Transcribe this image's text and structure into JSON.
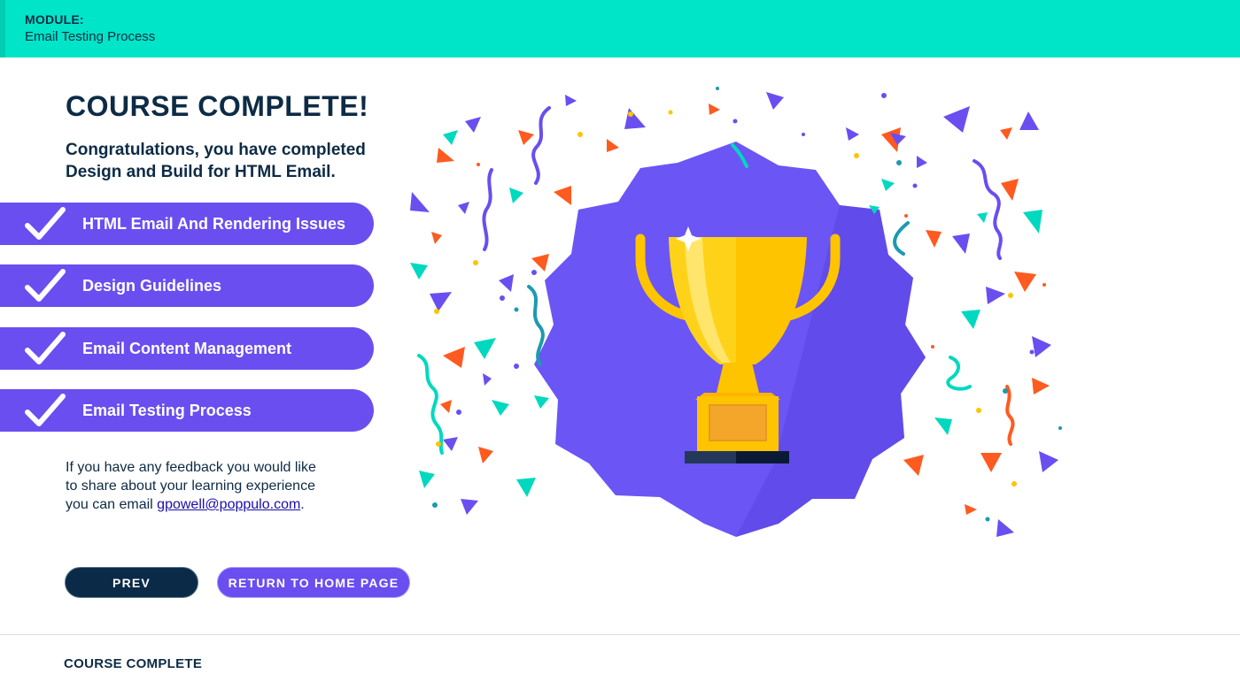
{
  "header": {
    "module_label": "MODULE:",
    "module_name": "Email Testing Process",
    "color": "#00e5c8"
  },
  "main": {
    "title": "COURSE COMPLETE!",
    "congrats": "Congratulations, you have completed Design and Build for HTML Email.",
    "lessons": [
      {
        "label": "HTML Email And Rendering Issues",
        "status": "completed",
        "icon": "checkmark-icon"
      },
      {
        "label": "Design Guidelines",
        "status": "completed",
        "icon": "checkmark-icon"
      },
      {
        "label": "Email Content Management",
        "status": "completed",
        "icon": "checkmark-icon"
      },
      {
        "label": "Email Testing Process",
        "status": "completed",
        "icon": "checkmark-icon"
      }
    ],
    "feedback": {
      "line1": "If you have any feedback you would like",
      "line2": "to share about your learning experience",
      "line3_prefix": "you can email ",
      "email": "gpowell@poppulo.com",
      "line3_suffix": "."
    },
    "illustration": "trophy-badge-confetti"
  },
  "nav": {
    "prev_label": "PREV",
    "home_label": "RETURN TO HOME PAGE"
  },
  "footer": {
    "page_title": "COURSE COMPLETE"
  },
  "colors": {
    "accent_purple": "#6a4ef0",
    "dark_navy": "#0a2a47",
    "teal": "#00e5c8",
    "confetti_orange": "#ff5a1f",
    "trophy_gold": "#ffc400"
  }
}
